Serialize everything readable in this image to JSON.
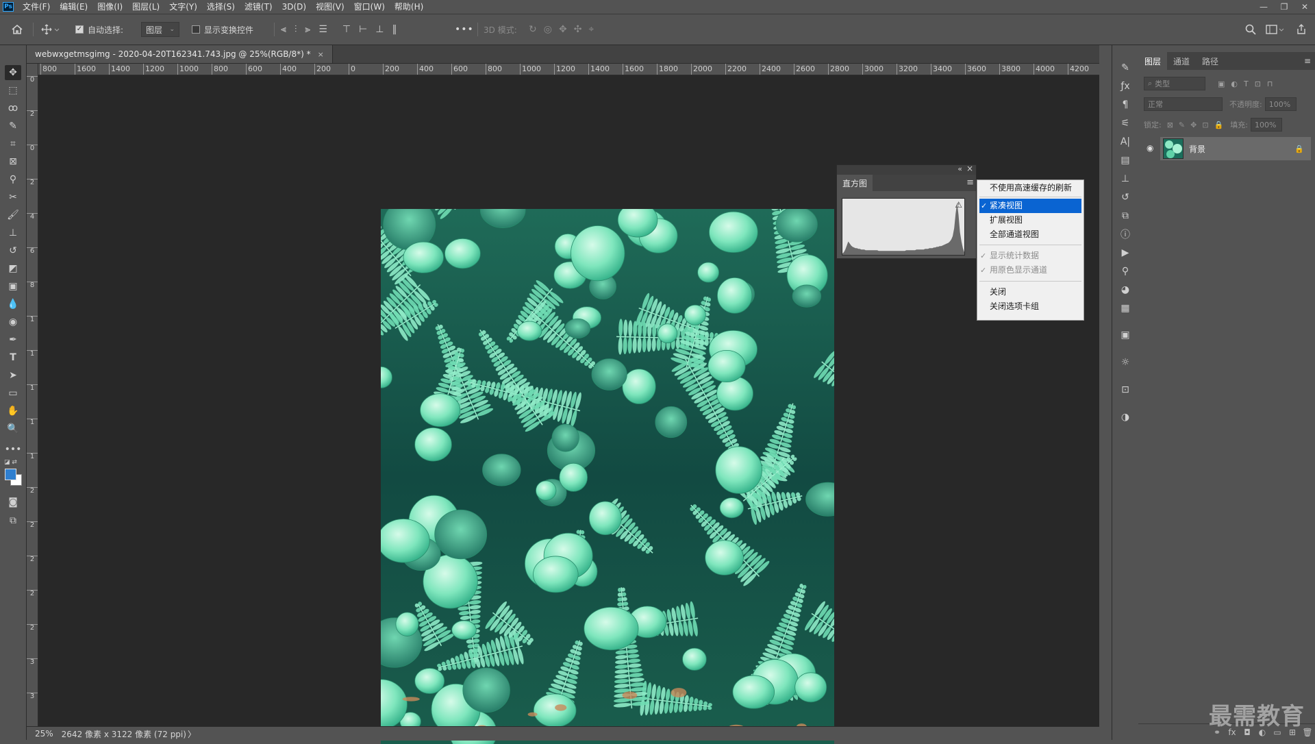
{
  "app": {
    "logo": "Ps"
  },
  "menubar": {
    "items": [
      "文件(F)",
      "编辑(E)",
      "图像(I)",
      "图层(L)",
      "文字(Y)",
      "选择(S)",
      "滤镜(T)",
      "3D(D)",
      "视图(V)",
      "窗口(W)",
      "帮助(H)"
    ]
  },
  "window_controls": {
    "minimize": "—",
    "restore": "❐",
    "close": "✕"
  },
  "options": {
    "auto_select_label": "自动选择:",
    "auto_select_checked": "✓",
    "auto_select_target": "图层",
    "show_transform_label": "显示变换控件",
    "more": "•••",
    "mode_3d_label": "3D 模式:"
  },
  "document": {
    "tab_title": "webwxgetmsgimg - 2020-04-20T162341.743.jpg @ 25%(RGB/8*) *",
    "tab_close": "×"
  },
  "hruler": {
    "ticks": [
      "800",
      "1600",
      "1400",
      "1200",
      "1000",
      "800",
      "600",
      "400",
      "200",
      "0",
      "200",
      "400",
      "600",
      "800",
      "1000",
      "1200",
      "1400",
      "1600",
      "1800",
      "2000",
      "2200",
      "2400",
      "2600",
      "2800",
      "3000",
      "3200",
      "3400",
      "3600",
      "3800",
      "4000",
      "4200"
    ]
  },
  "vruler": {
    "ticks": [
      "0",
      "2",
      "0",
      "2",
      "4",
      "6",
      "8",
      "1",
      "1",
      "1",
      "1",
      "1",
      "2",
      "2",
      "2",
      "2",
      "2",
      "3",
      "3"
    ]
  },
  "status": {
    "zoom": "25%",
    "doc_info": "2642 像素 x 3122 像素 (72 ppi)",
    "arrow": "〉"
  },
  "histogram": {
    "tab_label": "直方图",
    "collapse": "«",
    "close": "×",
    "menu_icon": "≡",
    "warning": "⚠",
    "levels": [
      2,
      4,
      8,
      14,
      20,
      17,
      14,
      12,
      11,
      10,
      10,
      9,
      9,
      8,
      8,
      8,
      7,
      7,
      7,
      7,
      7,
      7,
      7,
      7,
      7,
      6,
      6,
      6,
      6,
      6,
      6,
      6,
      6,
      6,
      6,
      6,
      6,
      6,
      6,
      6,
      6,
      6,
      6,
      6,
      7,
      7,
      7,
      7,
      7,
      7,
      7,
      8,
      8,
      8,
      8,
      8,
      8,
      9,
      9,
      9,
      10,
      10,
      10,
      11,
      11,
      12,
      12,
      13,
      13,
      14,
      15,
      16,
      17,
      18,
      20,
      23,
      28,
      40,
      62,
      78,
      60,
      34,
      20,
      10,
      4
    ]
  },
  "context_menu": {
    "items": [
      {
        "label": "不使用高速缓存的刷新",
        "check": "",
        "state": "normal"
      },
      {
        "label": "紧凑视图",
        "check": "✓",
        "state": "selected"
      },
      {
        "label": "扩展视图",
        "check": "",
        "state": "normal"
      },
      {
        "label": "全部通道视图",
        "check": "",
        "state": "normal"
      },
      {
        "label": "显示统计数据",
        "check": "✓",
        "state": "disabled"
      },
      {
        "label": "用原色显示通道",
        "check": "✓",
        "state": "disabled"
      },
      {
        "label": "关闭",
        "check": "",
        "state": "normal"
      },
      {
        "label": "关闭选项卡组",
        "check": "",
        "state": "normal"
      }
    ]
  },
  "layers": {
    "tabs": [
      "图层",
      "通道",
      "路径"
    ],
    "filter_placeholder": "类型",
    "blend_mode": "正常",
    "opacity_label": "不透明度:",
    "opacity_value": "100%",
    "lock_label": "锁定:",
    "fill_label": "填充:",
    "fill_value": "100%",
    "layer_name": "背景",
    "lock_icon": "🔒",
    "visibility_icon": "👁",
    "bottom_icons": [
      "⚭",
      "fx",
      "◘",
      "◐",
      "▭",
      "⊞",
      "🗑"
    ]
  },
  "watermark": "最需教育",
  "colors": {
    "ui_bg": "#535353",
    "canvas_bg": "#282828",
    "menu_selected": "#0a64d2",
    "foreground": "#2f7fcf",
    "background": "#ffffff"
  }
}
